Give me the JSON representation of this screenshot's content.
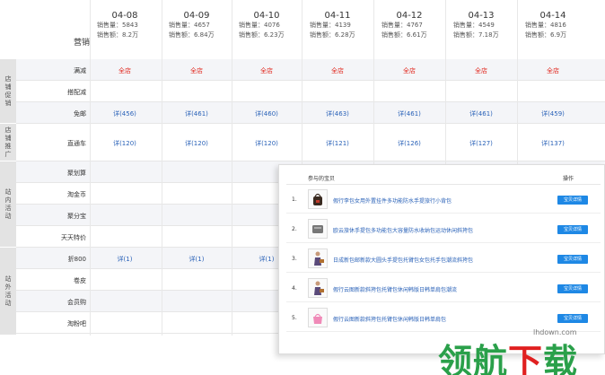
{
  "header": {
    "section_label": "营销",
    "sales_qty_label": "销售量：",
    "sales_amt_label": "销售额：",
    "days": [
      {
        "date": "04-08",
        "qty": "5843",
        "amt": "8.2万"
      },
      {
        "date": "04-09",
        "qty": "4657",
        "amt": "6.84万"
      },
      {
        "date": "04-10",
        "qty": "4076",
        "amt": "6.23万"
      },
      {
        "date": "04-11",
        "qty": "4139",
        "amt": "6.28万"
      },
      {
        "date": "04-12",
        "qty": "4767",
        "amt": "6.61万"
      },
      {
        "date": "04-13",
        "qty": "4549",
        "amt": "7.18万"
      },
      {
        "date": "04-14",
        "qty": "4816",
        "amt": "6.9万"
      }
    ]
  },
  "groups": [
    {
      "label": "店铺促销",
      "rows": [
        "满减",
        "搭配减",
        "免邮"
      ]
    },
    {
      "label": "店铺推广",
      "rows": [
        "直通车",
        "聚划算"
      ]
    },
    {
      "label": "站内活动",
      "rows": [
        "淘金币",
        "聚划算",
        "天天特价"
      ]
    },
    {
      "label": "站外活动",
      "rows": [
        "折800",
        "卷皮",
        "会员购",
        "淘粉吧"
      ]
    }
  ],
  "rows": [
    {
      "label": "满减",
      "cells": [
        "全店",
        "全店",
        "全店",
        "全店",
        "全店",
        "全店",
        "全店"
      ],
      "color": "red"
    },
    {
      "label": "搭配减",
      "cells": [],
      "color": "blue"
    },
    {
      "label": "免邮",
      "cells": [
        "详(456)",
        "详(461)",
        "详(460)",
        "详(463)",
        "详(461)",
        "详(461)",
        "详(459)"
      ],
      "color": "blue"
    },
    {
      "label": "直通车",
      "cells": [
        "详(120)",
        "详(120)",
        "详(120)",
        "详(121)",
        "详(126)",
        "详(127)",
        "详(137)"
      ],
      "color": "blue"
    },
    {
      "label": "聚划算",
      "cells": [],
      "color": "blue"
    },
    {
      "label": "淘金币",
      "cells": [],
      "color": "blue"
    },
    {
      "label": "聚分宝",
      "cells": [],
      "color": "blue"
    },
    {
      "label": "天天特价",
      "cells": [],
      "color": "blue"
    },
    {
      "label": "折800",
      "cells": [
        "详(1)",
        "详(1)",
        "详(1)"
      ],
      "color": "blue"
    },
    {
      "label": "卷皮",
      "cells": [],
      "color": "blue"
    },
    {
      "label": "会员购",
      "cells": [],
      "color": "blue"
    },
    {
      "label": "淘粉吧",
      "cells": [],
      "color": "blue"
    }
  ],
  "popup": {
    "col_product": "参与的宝贝",
    "col_action": "操作",
    "detail_btn": "宝贝详情",
    "items": [
      {
        "num": "1.",
        "title": "假行李包女用外置挂件多功能防水手提旅行小背包",
        "thumb": "bag-dark-icon"
      },
      {
        "num": "2.",
        "title": "欧云旅休手提包多功能包大容量防水收纳包运动休闲斜挎包",
        "thumb": "bag-gray-icon"
      },
      {
        "num": "3.",
        "title": "日成新包邮新款大圆头手提包托臂包女包托手包潮流斜挎包",
        "thumb": "bag-model-icon"
      },
      {
        "num": "4.",
        "title": "假行云图新款斜挎包托臂包休闲韩版日韩单肩包潮流",
        "thumb": "bag-model-icon"
      },
      {
        "num": "5.",
        "title": "假行云图新款斜挎包托臂包休闲韩版日韩单肩包",
        "thumb": "bag-pink-icon"
      }
    ]
  },
  "watermark": {
    "site": "lhdown.com",
    "text_green1": "领航",
    "text_red": "下",
    "text_green2": "载"
  }
}
